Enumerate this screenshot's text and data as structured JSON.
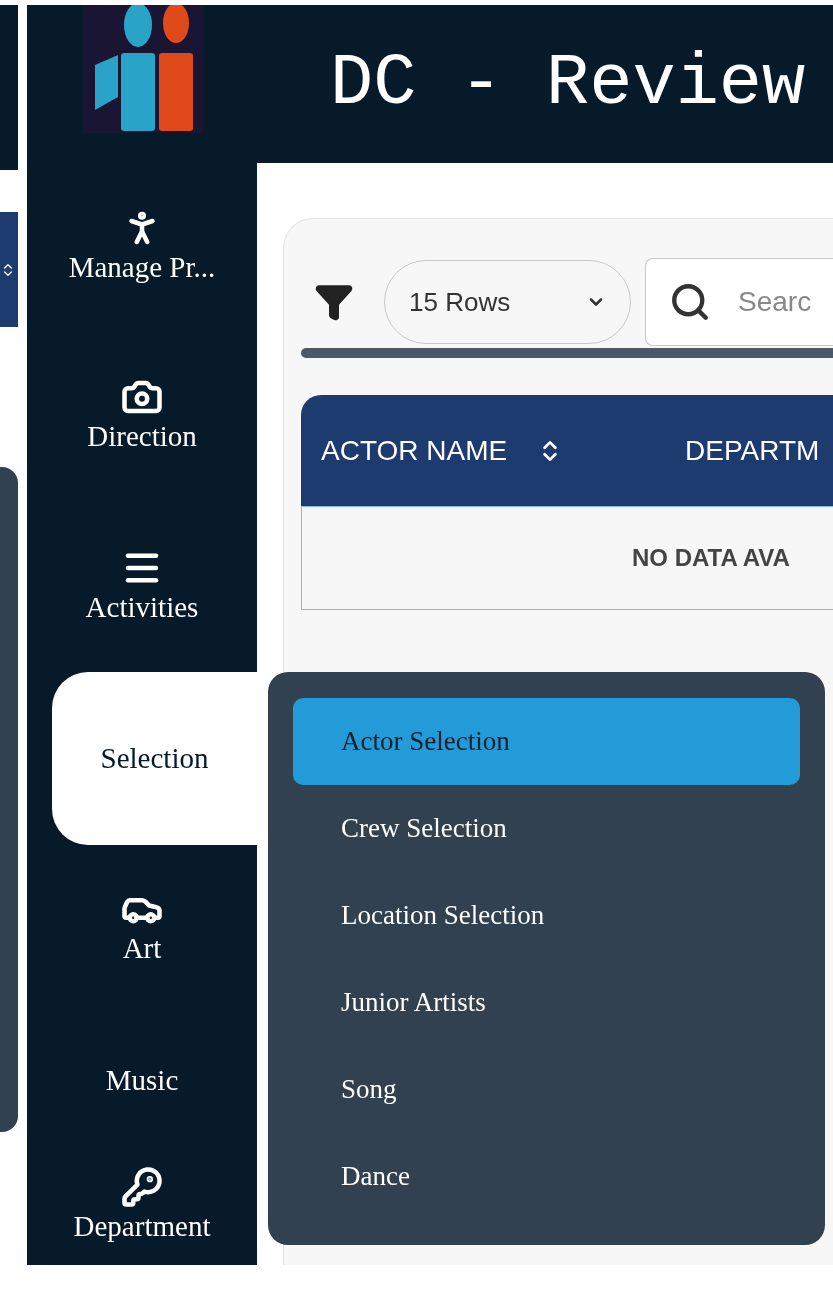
{
  "header": {
    "title": "DC - Review"
  },
  "sidebar": {
    "items": [
      {
        "label": "Manage Pr...",
        "selected": false
      },
      {
        "label": "Direction",
        "selected": false
      },
      {
        "label": "Activities",
        "selected": false
      },
      {
        "label": "Selection",
        "selected": true
      },
      {
        "label": "Art",
        "selected": false
      },
      {
        "label": "Music",
        "selected": false
      },
      {
        "label": "Department",
        "selected": false
      }
    ]
  },
  "toolbar": {
    "rows_select": "15 Rows",
    "search": {
      "placeholder": "Searc"
    }
  },
  "table": {
    "columns": [
      {
        "label": "ACTOR NAME",
        "sortable": true
      },
      {
        "label": "DEPARTM",
        "sortable": false
      }
    ],
    "empty_message": "NO DATA AVA"
  },
  "submenu": {
    "items": [
      {
        "label": "Actor Selection",
        "selected": true
      },
      {
        "label": "Crew Selection",
        "selected": false
      },
      {
        "label": "Location Selection",
        "selected": false
      },
      {
        "label": "Junior Artists",
        "selected": false
      },
      {
        "label": "Song",
        "selected": false
      },
      {
        "label": "Dance",
        "selected": false
      }
    ]
  }
}
